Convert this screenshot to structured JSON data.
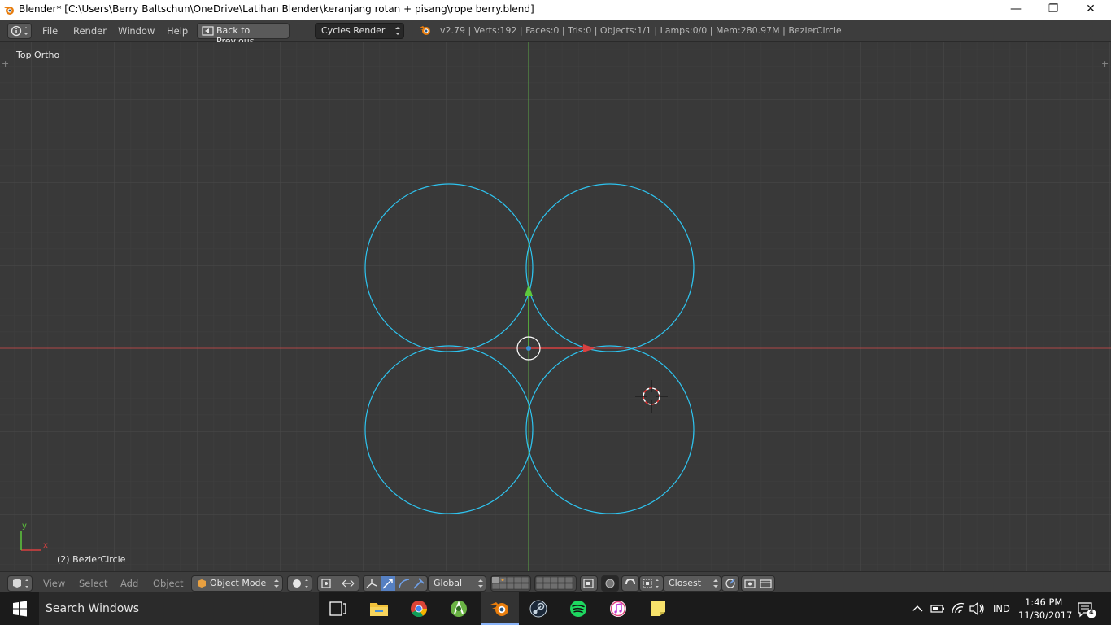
{
  "window": {
    "title": "Blender* [C:\\Users\\Berry Baltschun\\OneDrive\\Latihan Blender\\keranjang rotan + pisang\\rope berry.blend]",
    "minimize": "—",
    "maximize": "❐",
    "close": "✕"
  },
  "menubar": {
    "items": [
      "File",
      "Render",
      "Window",
      "Help"
    ],
    "back_label": "Back to Previous",
    "engine": "Cycles Render",
    "stats": "v2.79 | Verts:192 | Faces:0 | Tris:0 | Objects:1/1 | Lamps:0/0 | Mem:280.97M | BezierCircle"
  },
  "viewport": {
    "view_label": "Top Ortho",
    "object_label": "(2) BezierCircle",
    "axis_y": "y",
    "axis_x": "x",
    "colors": {
      "background": "#393939",
      "curve": "#2ec4f0",
      "x_axis": "#c83c3c",
      "y_axis": "#5fb84a"
    }
  },
  "bottombar": {
    "items": [
      "View",
      "Select",
      "Add",
      "Object"
    ],
    "mode": "Object Mode",
    "orientation": "Global",
    "snap_target": "Closest"
  },
  "taskbar": {
    "search_placeholder": "Search Windows",
    "language": "IND",
    "time": "1:46 PM",
    "date": "11/30/2017",
    "notifications": "4"
  }
}
